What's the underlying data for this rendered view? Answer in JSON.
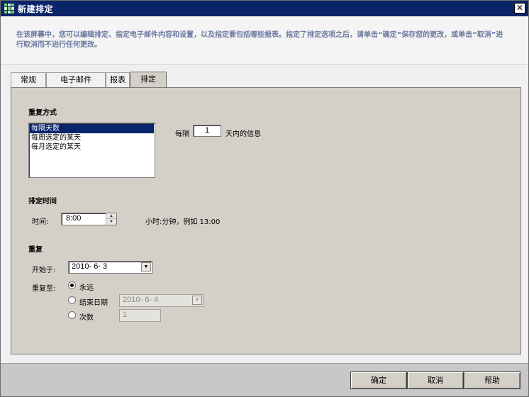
{
  "window": {
    "title": "新建排定",
    "close_glyph": "✕"
  },
  "description": "在该屏幕中，您可以编辑排定、指定电子邮件内容和设置，以及指定要包括哪些报表。指定了排定选项之后，请单击“确定”保存您的更改，或单击“取消”进行取消而不进行任何更改。",
  "tabs": [
    {
      "label": "常规"
    },
    {
      "label": "电子邮件"
    },
    {
      "label": "报表"
    },
    {
      "label": "排定",
      "active": true
    }
  ],
  "recurrence": {
    "section_title": "重复方式",
    "options": [
      "每隔天数",
      "每周选定的某天",
      "每月选定的某天"
    ],
    "selected": "每隔天数",
    "interval_prefix": "每隔",
    "interval_value": "1",
    "interval_suffix": "天内的信息"
  },
  "schedule_time": {
    "section_title": "排定时间",
    "time_label": "时间:",
    "time_value": "8:00",
    "hint": "小时:分钟，例如 13:00"
  },
  "repeat": {
    "section_title": "重复",
    "start_label": "开始于:",
    "start_value": "2010- 6- 3",
    "repeat_until_label": "重复至:",
    "option_forever": "永远",
    "option_end_date": "结束日期",
    "end_date_value": "2010- 6- 4",
    "option_count": "次数",
    "count_value": "1",
    "selected_option": "永远"
  },
  "buttons": {
    "ok": "确定",
    "cancel": "取消",
    "help": "帮助"
  }
}
